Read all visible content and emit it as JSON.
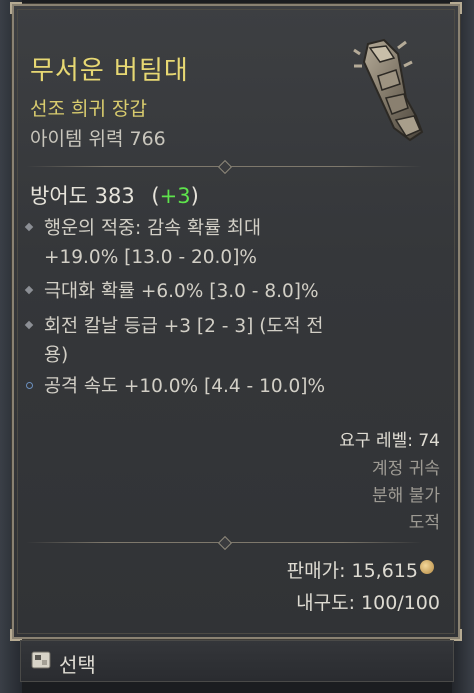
{
  "item": {
    "name": "무서운 버팀대",
    "rarity_type": "선조 희귀 장갑",
    "power": "아이템 위력 766",
    "icon": "gauntlet-icon"
  },
  "armor": {
    "label": "방어도 383",
    "bonus": "+3",
    "open_paren": "(",
    "close_paren": ")"
  },
  "affixes": [
    {
      "line1": "행운의 적중: 감속 확률 최대",
      "line2": "+19.0% [13.0 - 20.0]%"
    },
    {
      "line1": "극대화 확률 +6.0% [3.0 - 8.0]%"
    },
    {
      "line1": "회전 칼날 등급 +3 [2 - 3] (도적 전",
      "line2": "용)"
    },
    {
      "line1": "공격 속도 +10.0% [4.4 - 10.0]%"
    }
  ],
  "requirements": {
    "level": "요구 레벨: 74",
    "account_bound": "계정 귀속",
    "no_salvage": "분해 불가",
    "class": "도적"
  },
  "sell_price": "판매가: 15,615",
  "durability": "내구도: 100/100",
  "action": {
    "label": "선택",
    "icon": "controller-key-icon"
  },
  "colors": {
    "title": "#e7d873",
    "bonus_green": "#5ee44c",
    "panel_bg": "#36383b",
    "border": "#8a8272"
  }
}
